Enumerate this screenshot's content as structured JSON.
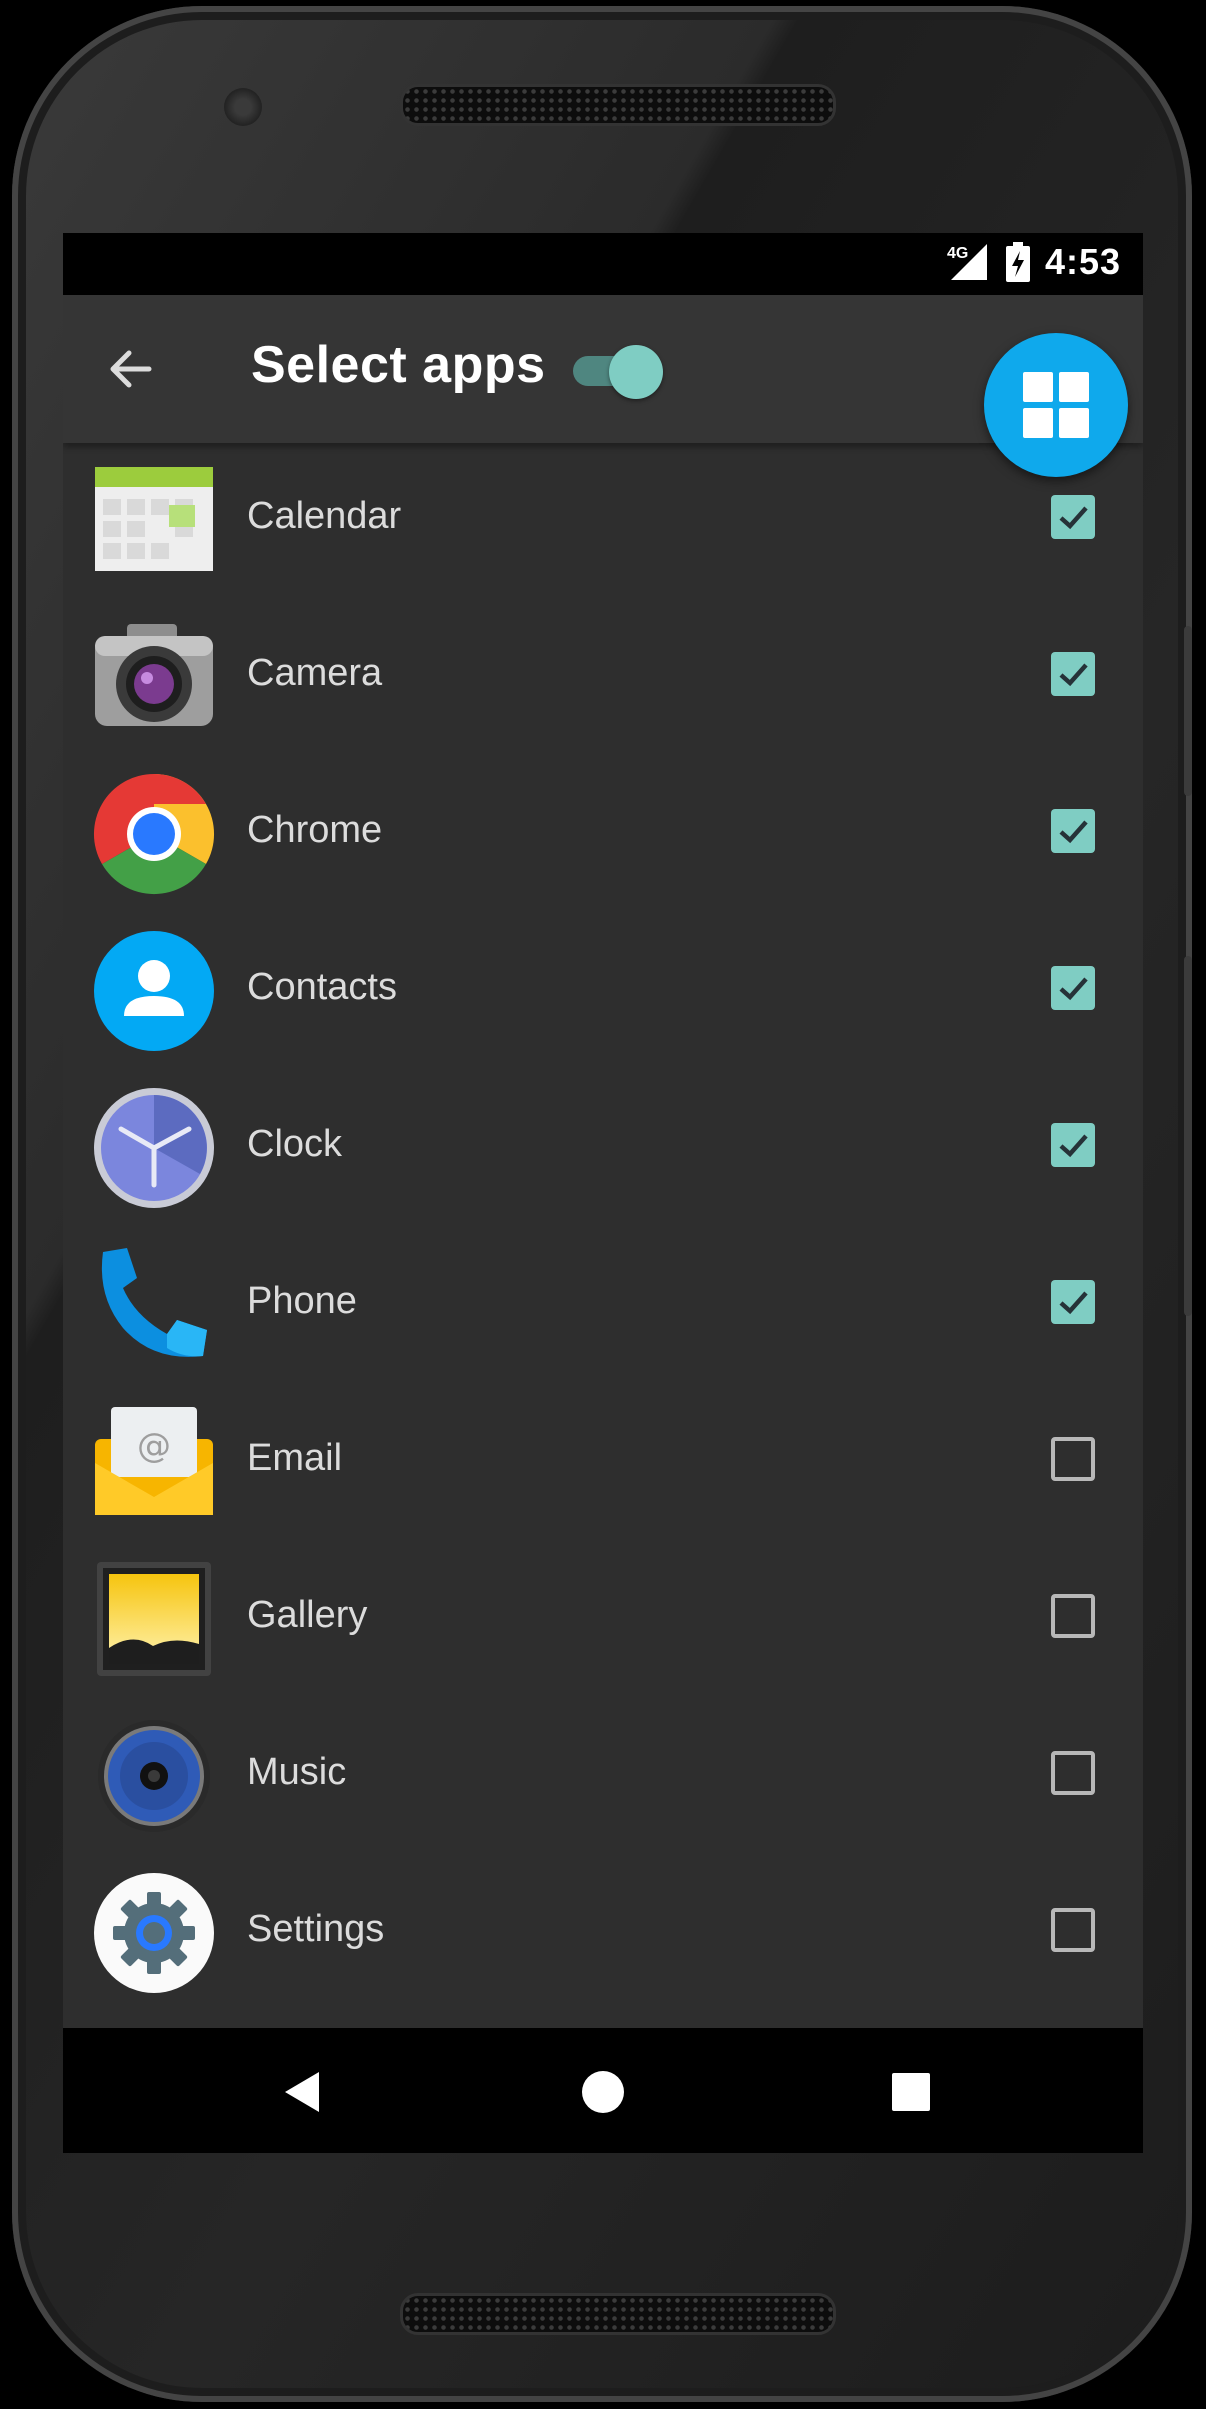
{
  "status": {
    "network": "4G",
    "time": "4:53"
  },
  "appbar": {
    "title": "Select apps",
    "toggle_on": true
  },
  "colors": {
    "accent": "#7fcdc3",
    "fab": "#0fa9ec",
    "background": "#2e2e2e",
    "appbar": "#353535"
  },
  "apps": [
    {
      "label": "Calendar",
      "icon": "calendar-icon",
      "checked": true
    },
    {
      "label": "Camera",
      "icon": "camera-icon",
      "checked": true
    },
    {
      "label": "Chrome",
      "icon": "chrome-icon",
      "checked": true
    },
    {
      "label": "Contacts",
      "icon": "contacts-icon",
      "checked": true
    },
    {
      "label": "Clock",
      "icon": "clock-icon",
      "checked": true
    },
    {
      "label": "Phone",
      "icon": "phone-icon",
      "checked": true
    },
    {
      "label": "Email",
      "icon": "email-icon",
      "checked": false
    },
    {
      "label": "Gallery",
      "icon": "gallery-icon",
      "checked": false
    },
    {
      "label": "Music",
      "icon": "music-icon",
      "checked": false
    },
    {
      "label": "Settings",
      "icon": "settings-icon",
      "checked": false
    }
  ]
}
